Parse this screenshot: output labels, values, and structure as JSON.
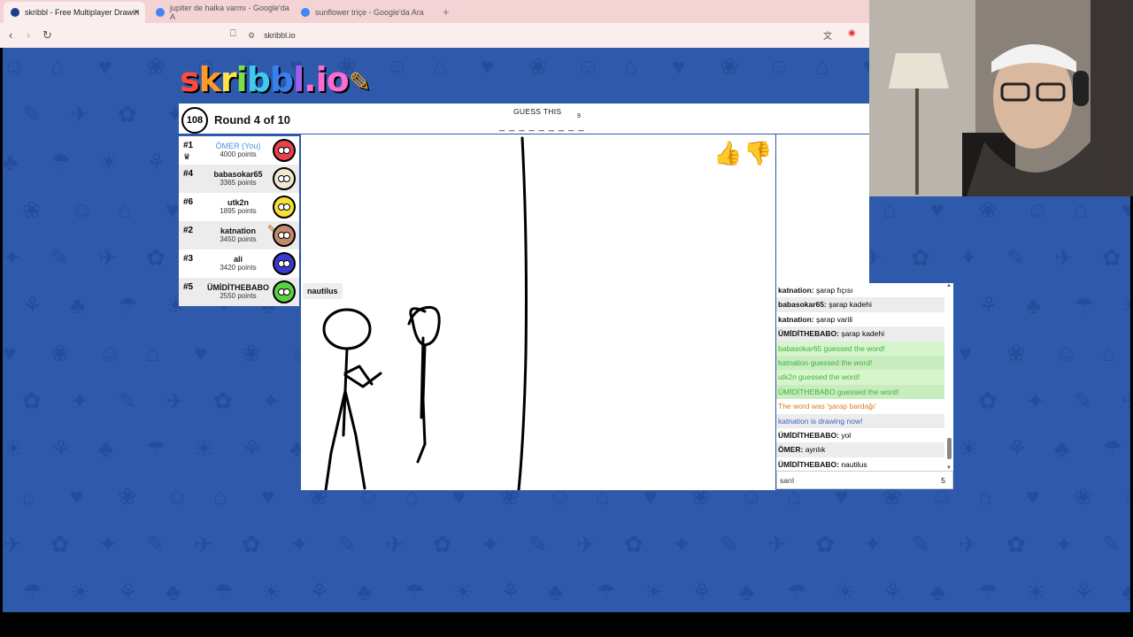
{
  "browser": {
    "tabs": [
      {
        "title": "skribbl - Free Multiplayer Drawin",
        "fav_color": "#1a3d8f"
      },
      {
        "title": "jupiter de halka varmı - Google'da A",
        "fav_color": "#4285f4"
      },
      {
        "title": "sunflower triçe - Google'da Ara",
        "fav_color": "#4285f4"
      }
    ],
    "tab_close": "×",
    "new_tab": "+",
    "back": "‹",
    "forward": "›",
    "reload": "↻",
    "url": "skribbl.io"
  },
  "game": {
    "logo_letters": [
      {
        "c": "s",
        "color": "#ff4a3a"
      },
      {
        "c": "k",
        "color": "#ff9a2a"
      },
      {
        "c": "r",
        "color": "#ffe14a"
      },
      {
        "c": "i",
        "color": "#7ce04a"
      },
      {
        "c": "b",
        "color": "#40c8f0"
      },
      {
        "c": "b",
        "color": "#3a7ff0"
      },
      {
        "c": "l",
        "color": "#a35cf0"
      },
      {
        "c": ".",
        "color": "#ff6ad0"
      },
      {
        "c": "i",
        "color": "#ff6ad0"
      },
      {
        "c": "o",
        "color": "#ff6ad0"
      }
    ],
    "timer": "108",
    "round": "Round 4 of 10",
    "guess_label": "GUESS THIS",
    "word_length": "9",
    "blanks": "_ _ _ _ _ _ _ _ _",
    "tooltip": "nautilus"
  },
  "players": [
    {
      "rank": "#1",
      "name": "ÖMER (You)",
      "points": "4000 points",
      "color": "#e8424a",
      "you": true
    },
    {
      "rank": "#4",
      "name": "babasokar65",
      "points": "3365 points",
      "color": "#f0e8d0",
      "you": false
    },
    {
      "rank": "#6",
      "name": "utk2n",
      "points": "1895 points",
      "color": "#f5e035",
      "you": false
    },
    {
      "rank": "#2",
      "name": "katnation",
      "points": "3450 points",
      "color": "#c58a6a",
      "you": false
    },
    {
      "rank": "#3",
      "name": "ali",
      "points": "3420 points",
      "color": "#3a3ad0",
      "you": false
    },
    {
      "rank": "#5",
      "name": "ÜMİDİTHEBABO",
      "points": "2550 points",
      "color": "#5ad040",
      "you": false
    }
  ],
  "chat": {
    "messages": [
      {
        "who": "katnation:",
        "text": "şarap fıçısı",
        "type": "normal"
      },
      {
        "who": "babasokar65:",
        "text": "şarap kadehi",
        "type": "normal"
      },
      {
        "who": "katnation:",
        "text": "şarap varili",
        "type": "normal"
      },
      {
        "who": "ÜMİDİTHEBABO:",
        "text": "şarap kadehi",
        "type": "normal"
      },
      {
        "who": "",
        "text": "babasokar65 guessed the word!",
        "type": "green"
      },
      {
        "who": "",
        "text": "katnation guessed the word!",
        "type": "green"
      },
      {
        "who": "",
        "text": "utk2n guessed the word!",
        "type": "green"
      },
      {
        "who": "",
        "text": "ÜMİDİTHEBABO guessed the word!",
        "type": "green"
      },
      {
        "who": "",
        "text": "The word was 'şarap bardağı'",
        "type": "orange"
      },
      {
        "who": "",
        "text": "katnation is drawing now!",
        "type": "blue"
      },
      {
        "who": "ÜMİDİTHEBABO:",
        "text": "yol",
        "type": "normal"
      },
      {
        "who": "ÖMER:",
        "text": "ayrılık",
        "type": "normal"
      },
      {
        "who": "ÜMİDİTHEBABO:",
        "text": "nautilus",
        "type": "normal"
      }
    ],
    "input_value": "sarıl",
    "char_count": "5"
  },
  "icons": {
    "thumb_up": "👍",
    "thumb_down": "👎",
    "crown": "♛",
    "pencil": "✎"
  }
}
